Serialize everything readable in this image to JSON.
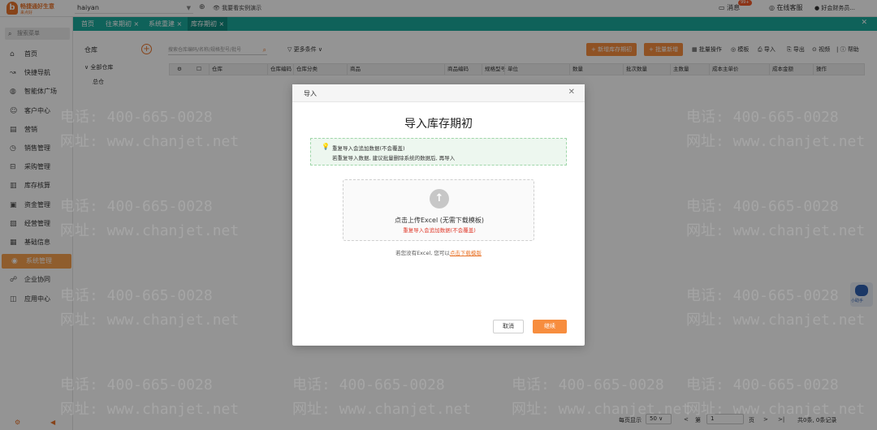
{
  "topbar": {
    "logo_text": "畅捷通好生意",
    "logo_sub": "来点好",
    "account": "haiyan",
    "demo": "我要看实例演示",
    "message": "消息",
    "message_badge": "99+",
    "support": "在线客服",
    "user": "好会财务员..."
  },
  "sidebar": {
    "search_placeholder": "搜索菜单",
    "items": [
      {
        "label": "首页",
        "icon": "home-icon"
      },
      {
        "label": "快捷导航",
        "icon": "navigation-icon"
      },
      {
        "label": "智能体广场",
        "icon": "agent-icon"
      },
      {
        "label": "客户中心",
        "icon": "customer-icon"
      },
      {
        "label": "营销",
        "icon": "marketing-icon"
      },
      {
        "label": "销售管理",
        "icon": "sales-icon"
      },
      {
        "label": "采购管理",
        "icon": "purchase-icon"
      },
      {
        "label": "库存核算",
        "icon": "inventory-icon"
      },
      {
        "label": "资金管理",
        "icon": "funds-icon"
      },
      {
        "label": "经营管理",
        "icon": "business-icon"
      },
      {
        "label": "基础信息",
        "icon": "info-icon"
      },
      {
        "label": "系统管理",
        "icon": "settings-icon",
        "active": true
      },
      {
        "label": "企业协同",
        "icon": "collaboration-icon"
      },
      {
        "label": "应用中心",
        "icon": "apps-icon"
      }
    ]
  },
  "tabs": [
    {
      "label": "首页"
    },
    {
      "label": "往来期初 ×"
    },
    {
      "label": "系统重建 ×"
    },
    {
      "label": "库存期初 ×",
      "active": true
    }
  ],
  "content": {
    "tree_title": "仓库",
    "tree_root": "全部仓库",
    "tree_child": "总仓",
    "search_placeholder": "搜索仓库编码/名称/规格型号/批号",
    "more_conditions": "更多条件",
    "add_button": "+ 新增库存期初",
    "batch_button": "+ 批量新增",
    "tools": [
      "批量操作",
      "模板",
      "导入",
      "导出",
      "视频",
      "帮助"
    ],
    "columns": [
      "仓库",
      "仓库编码",
      "仓库分类",
      "商品",
      "商品编码",
      "规格型号",
      "单位",
      "数量",
      "批次数量",
      "主数量",
      "成本主单价",
      "成本金额",
      "操作"
    ]
  },
  "footer": {
    "per_page_label": "每页显示",
    "per_page": "50",
    "page_prefix": "第",
    "page_value": "1",
    "page_suffix": "页",
    "total": "共0条, 0条记录"
  },
  "watermark": {
    "phone": "电话: 400-665-0028",
    "site": "网址: www.chanjet.net"
  },
  "modal": {
    "header": "导入",
    "title": "导入库存期初",
    "notice_line1": "重复导入会追加数据(不会覆盖)",
    "notice_line2": "若重复导入数据, 建议批量删除系统的数据后, 再导入",
    "upload_text": "点击上传Excel (无需下载模板)",
    "upload_warning": "重复导入会追加数据(不会覆盖)",
    "tip_text": "若您没有Excel, 您可以",
    "tip_link": "点击下载模版",
    "cancel": "取消",
    "continue": "继续"
  },
  "assistant_label": "小助手"
}
